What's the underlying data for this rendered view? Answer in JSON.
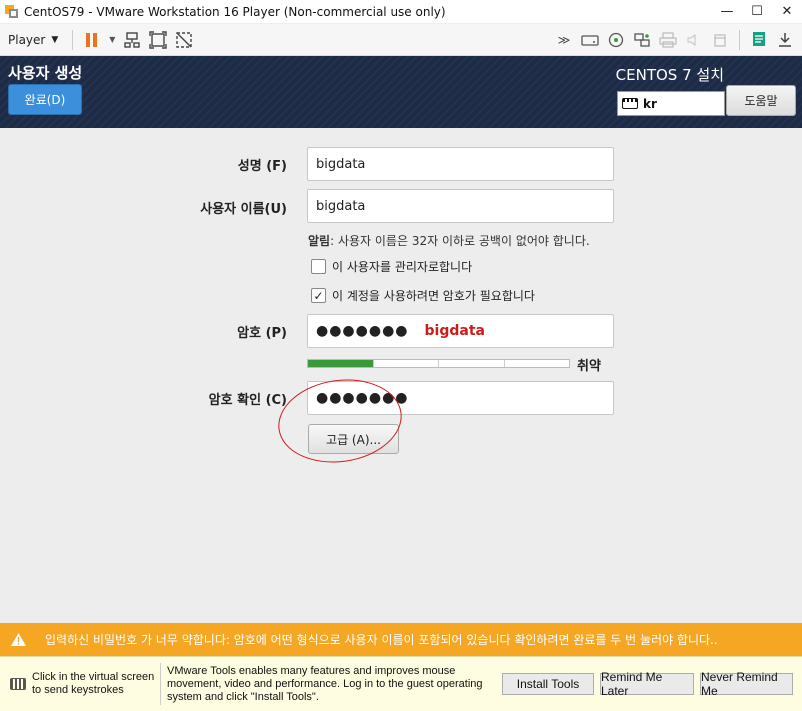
{
  "window": {
    "title": "CentOS79 - VMware Workstation 16 Player (Non-commercial use only)",
    "minimize": "—",
    "restore": "☐",
    "close": "✕"
  },
  "toolbar": {
    "player_label": "Player"
  },
  "installer": {
    "page_title": "사용자 생성",
    "done_button": "완료(D)",
    "product_title": "CENTOS 7 설치",
    "keyboard_layout": "kr",
    "help_button": "도움말"
  },
  "form": {
    "fullname_label": "성명 (F)",
    "fullname_value": "bigdata",
    "username_label": "사용자 이름(U)",
    "username_value": "bigdata",
    "hint_bold": "알림",
    "hint_text": ": 사용자 이름은 32자 이하로 공백이 없어야 합니다.",
    "admin_checkbox_label": "이 사용자를 관리자로합니다",
    "admin_checked": false,
    "password_required_label": "이 계정을 사용하려면 암호가 필요합니다",
    "password_required_checked": true,
    "password_label": "암호 (P)",
    "password_value": "●●●●●●●",
    "password_annotation": "bigdata",
    "strength_label": "취약",
    "strength_level": 0.25,
    "confirm_label": "암호 확인 (C)",
    "confirm_value": "●●●●●●●",
    "advanced_button": "고급 (A)..."
  },
  "warning": {
    "text": "입력하신 비밀번호 가 너무 약합니다: 암호에 어떤 형식으로 사용자 이름이 포함되어 있습니다  확인하려면 완료를 두 번 눌러야 합니다.."
  },
  "tools": {
    "click_hint": "Click in the virtual screen to send keystrokes",
    "message": "VMware Tools enables many features and improves mouse movement, video and performance. Log in to the guest operating system and click \"Install Tools\".",
    "install_button": "Install Tools",
    "remind_later_button": "Remind Me Later",
    "never_remind_button": "Never Remind Me"
  },
  "colors": {
    "header_bg": "#1e2b47",
    "done_button": "#3b8fdb",
    "warning_bg": "#f5a623",
    "annotation_red": "#d11b1b",
    "strength_fill": "#3a9a3a"
  }
}
